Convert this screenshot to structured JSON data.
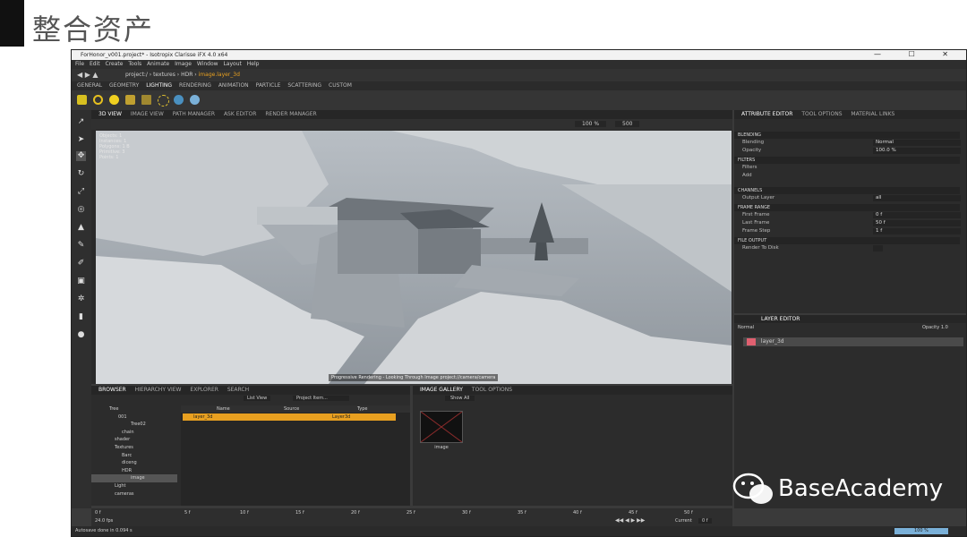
{
  "slide": {
    "title": "整合资产"
  },
  "window": {
    "title": "ForHonor_v001.project* - Isotropix Clarisse iFX 4.0 x64",
    "controls": "— ☐ ✕"
  },
  "menu": [
    "File",
    "Edit",
    "Create",
    "Tools",
    "Animate",
    "Image",
    "Window",
    "Layout",
    "Help"
  ],
  "path": {
    "crumbs": "project:/ › textures › HDR ›",
    "current": "image.layer_3d"
  },
  "shelf_tabs": [
    "GENERAL",
    "GEOMETRY",
    "LIGHTING",
    "RENDERING",
    "ANIMATION",
    "PARTICLE",
    "SCATTERING",
    "CUSTOM"
  ],
  "viewport": {
    "tabs": [
      "3D VIEW",
      "IMAGE VIEW",
      "PATH MANAGER",
      "ASK EDITOR",
      "RENDER MANAGER"
    ],
    "info_lines": [
      "Objects: 1",
      "Instances: 1",
      "Polygons: 1 B",
      "Primitive: 3",
      "Points: 1"
    ],
    "progress": "Progressive Rendering - Looking Through Image  project://camera/camera",
    "zoom": "100 %",
    "value": "500"
  },
  "attribute_editor": {
    "tabs": [
      "ATTRIBUTE EDITOR",
      "TOOL OPTIONS",
      "MATERIAL LINKS"
    ],
    "sections": [
      {
        "title": "BLENDING",
        "rows": [
          {
            "label": "Blending",
            "value": "Normal"
          },
          {
            "label": "Opacity",
            "value": "100.0 %"
          }
        ]
      },
      {
        "title": "FILTERS",
        "rows": [
          {
            "label": "Filters",
            "value": ""
          },
          {
            "label": "Add",
            "value": ""
          }
        ]
      },
      {
        "title": "CHANNELS",
        "rows": [
          {
            "label": "Output Layer",
            "value": "all"
          }
        ]
      },
      {
        "title": "FRAME RANGE",
        "rows": [
          {
            "label": "First Frame",
            "value": "0 f"
          },
          {
            "label": "Last Frame",
            "value": "50 f"
          },
          {
            "label": "Frame Step",
            "value": "1 f"
          }
        ]
      },
      {
        "title": "FILE OUTPUT",
        "rows": [
          {
            "label": "Render To Disk",
            "value": ""
          }
        ]
      }
    ]
  },
  "layer_editor": {
    "tab": "LAYER EDITOR",
    "blend": "Normal",
    "opacity_label": "Opacity",
    "opacity": "1.0",
    "layer": "layer_3d"
  },
  "browser": {
    "tabs": [
      "BROWSER",
      "HIERARCHY VIEW",
      "EXPLORER",
      "SEARCH"
    ],
    "view_mode": "List View",
    "filter": "Project Item...",
    "tree": [
      "Tree",
      "001",
      "Tree02",
      "chain",
      "shader",
      "Textures",
      "Barc",
      "diceng",
      "HDR",
      "image",
      "Light",
      "cameras"
    ],
    "columns": [
      "Name",
      "Source",
      "Type"
    ],
    "row": {
      "name": "layer_3d",
      "source": "",
      "type": "Layer3d"
    }
  },
  "gallery": {
    "tabs": [
      "IMAGE GALLERY",
      "TOOL OPTIONS"
    ],
    "show": "Show All",
    "item": "image"
  },
  "timeline": {
    "ticks": [
      "0 f",
      "5 f",
      "10 f",
      "15 f",
      "20 f",
      "25 f",
      "30 f",
      "35 f",
      "40 f",
      "45 f",
      "50 f"
    ],
    "fps": "24.0 fps",
    "current_label": "Current",
    "current": "0 f"
  },
  "status": {
    "message": "Autosave done in 0.094 s",
    "progress": "100 %"
  },
  "watermark": {
    "text": "BaseAcademy"
  }
}
